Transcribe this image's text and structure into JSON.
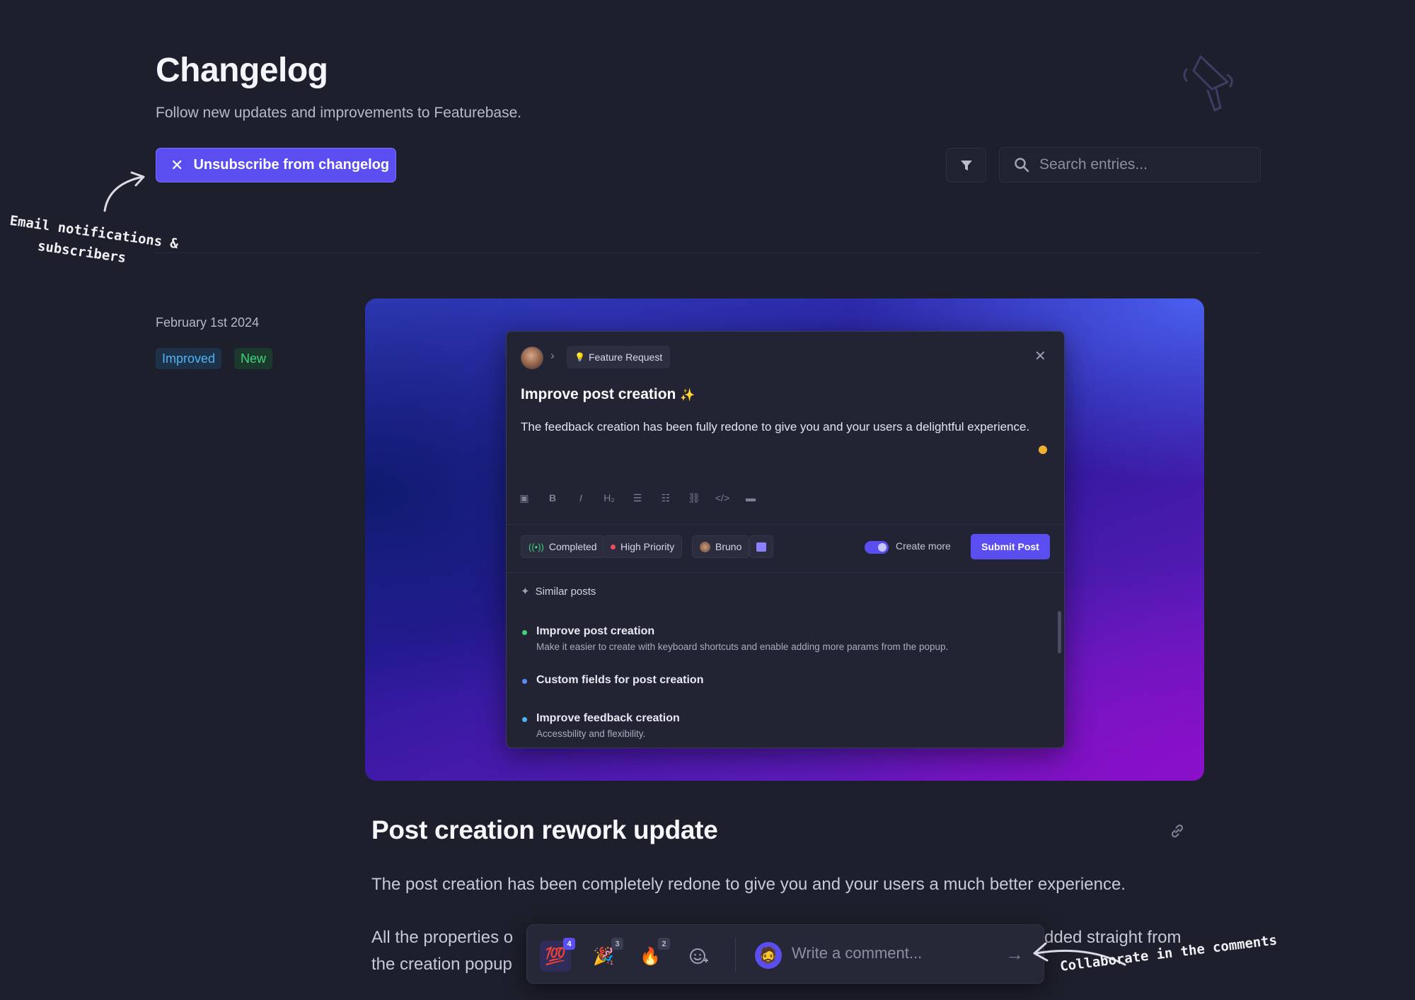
{
  "header": {
    "title": "Changelog",
    "subtitle": "Follow new updates and improvements to Featurebase.",
    "unsubscribe_label": "Unsubscribe from changelog",
    "search_placeholder": "Search entries..."
  },
  "annotations": {
    "email_note_line1": "Email notifications &",
    "email_note_line2": "subscribers",
    "comments_note": "Collaborate in the comments"
  },
  "entry": {
    "date": "February 1st 2024",
    "tags": [
      {
        "label": "Improved",
        "color": "#4fb3f4"
      },
      {
        "label": "New",
        "color": "#3fd47a"
      }
    ],
    "title": "Post creation rework update",
    "paragraph1": "The post creation has been completely redone to give you and your users a much better experience.",
    "paragraph2_start": "All the properties o",
    "paragraph2_end": "dded straight from",
    "paragraph2_line2": "the creation popup"
  },
  "modal": {
    "breadcrumb": "Feature Request",
    "title": "Improve post creation",
    "title_emoji": "✨",
    "body": "The feedback creation has been fully redone to give you and your users a delightful experience.",
    "chips": {
      "status": "Completed",
      "priority": "High Priority",
      "user": "Bruno"
    },
    "create_more_label": "Create more",
    "submit_label": "Submit Post",
    "similar_label": "Similar posts",
    "similar_posts": [
      {
        "title": "Improve post creation",
        "subtitle": "Make it easier to create with keyboard shortcuts and enable adding more params from the popup.",
        "dot_color": "#3fd47a"
      },
      {
        "title": "Custom fields for post creation",
        "subtitle": "",
        "dot_color": "#5b8bf5"
      },
      {
        "title": "Improve feedback creation",
        "subtitle": "Accessbility and flexibility.",
        "dot_color": "#4fb3f4"
      }
    ]
  },
  "comment_bar": {
    "reactions": [
      {
        "emoji": "💯",
        "count": "4"
      },
      {
        "emoji": "🎉",
        "count": "3"
      },
      {
        "emoji": "🔥",
        "count": "2"
      }
    ],
    "placeholder": "Write a comment..."
  },
  "colors": {
    "accent": "#5b4ef0",
    "background": "#1d1f2c"
  }
}
